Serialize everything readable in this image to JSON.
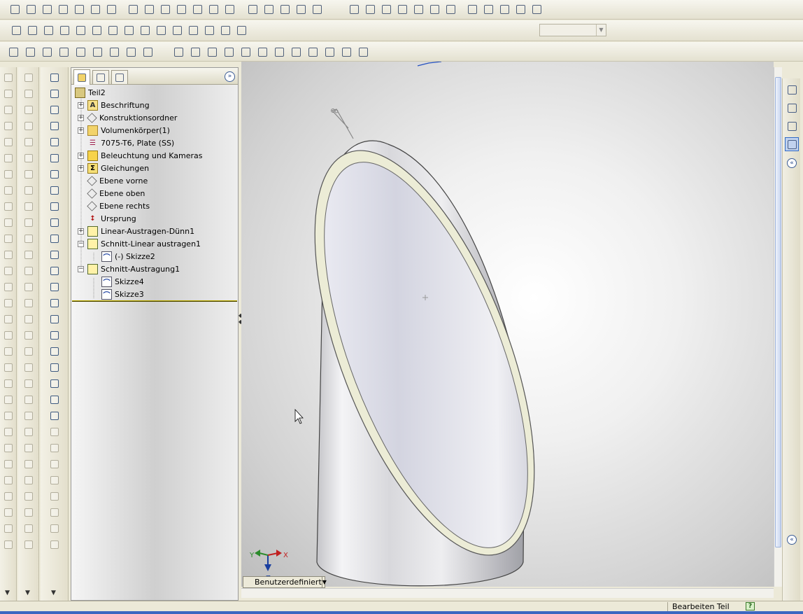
{
  "colors": {
    "chrome": "#ece9d8",
    "accent": "#316ac5",
    "rollback_bar": "#b8a800"
  },
  "toolbar_row1": [
    "new-icon",
    "open-icon",
    "save-icon",
    "print-icon",
    "print-preview-icon",
    "undo-icon",
    "redo-icon",
    "select-icon",
    "select-box-icon",
    "traffic-light-icon",
    "grid-icon",
    "options-icon",
    "help-icon",
    "camera-icon",
    "sketch-icon",
    "smart-dimension-icon",
    "point-icon",
    "spline-icon",
    "record-macro-icon",
    "zoom-to-fit-icon",
    "zoom-area-icon",
    "zoom-in-icon",
    "zoom-out-icon",
    "rotate-icon",
    "pan-icon",
    "view-orientation-icon",
    "wireframe-icon",
    "hidden-lines-icon",
    "shaded-icon",
    "shaded-edges-icon",
    "appearance-icon"
  ],
  "toolbar_row2": [
    "run-macro-icon",
    "stop-macro-icon",
    "record-icon",
    "new-macro-icon",
    "edit-macro-icon",
    "close-icon",
    "check-icon",
    "hole-icon",
    "wizard-icon",
    "mate-icon",
    "ref-geometry-icon",
    "curves-icon",
    "boundary-icon",
    "fillet-icon",
    "chamfer-icon"
  ],
  "toolbar_row3": [
    "spell-check-icon",
    "dimension-icon",
    "datum-icon",
    "note-icon",
    "surface-finish-icon",
    "weld-icon",
    "geometric-tolerance-icon",
    "table-icon",
    "datum-target-icon",
    "filter-icon",
    "select-filter-icon",
    "face-filter-icon",
    "edge-filter-icon",
    "vertex-filter-icon",
    "body-filter-icon",
    "plane-filter-icon",
    "axis-filter-icon",
    "point-filter-icon",
    "sketch-filter-icon",
    "annotation-filter-icon",
    "weldbead-filter-icon"
  ],
  "feature_tree": {
    "root": "Teil2",
    "items": [
      {
        "label": "Beschriftung",
        "icon": "annotation-icon",
        "expander": "+",
        "depth": 0
      },
      {
        "label": "Konstruktionsordner",
        "icon": "design-binder-icon",
        "expander": "+",
        "depth": 0
      },
      {
        "label": "Volumenkörper(1)",
        "icon": "solid-bodies-icon",
        "expander": "+",
        "depth": 0
      },
      {
        "label": "7075-T6, Plate (SS)",
        "icon": "material-icon",
        "expander": "",
        "depth": 0
      },
      {
        "label": "Beleuchtung und Kameras",
        "icon": "lights-cameras-icon",
        "expander": "+",
        "depth": 0
      },
      {
        "label": "Gleichungen",
        "icon": "equations-icon",
        "expander": "+",
        "depth": 0
      },
      {
        "label": "Ebene vorne",
        "icon": "plane-icon",
        "expander": "",
        "depth": 0
      },
      {
        "label": "Ebene oben",
        "icon": "plane-icon",
        "expander": "",
        "depth": 0
      },
      {
        "label": "Ebene rechts",
        "icon": "plane-icon",
        "expander": "",
        "depth": 0
      },
      {
        "label": "Ursprung",
        "icon": "origin-icon",
        "expander": "",
        "depth": 0
      },
      {
        "label": "Linear-Austragen-Dünn1",
        "icon": "extrude-thin-icon",
        "expander": "+",
        "depth": 0
      },
      {
        "label": "Schnitt-Linear austragen1",
        "icon": "cut-extrude-icon",
        "expander": "−",
        "depth": 0
      },
      {
        "label": "(-) Skizze2",
        "icon": "sketch-icon",
        "expander": "",
        "depth": 1
      },
      {
        "label": "Schnitt-Austragung1",
        "icon": "cut-sweep-icon",
        "expander": "−",
        "depth": 0
      },
      {
        "label": "Skizze4",
        "icon": "sketch-icon",
        "expander": "",
        "depth": 1
      },
      {
        "label": "Skizze3",
        "icon": "sketch-icon",
        "expander": "",
        "depth": 1
      }
    ]
  },
  "view_dropdown": {
    "value": "Benutzerdefiniert"
  },
  "triad": {
    "x": "X",
    "y": "Y",
    "z": "Z"
  },
  "status": {
    "mode": "Bearbeiten Teil",
    "help": "?"
  },
  "panel_controls": {
    "expand": "»",
    "collapse_top": "«",
    "collapse_bottom": "«"
  }
}
